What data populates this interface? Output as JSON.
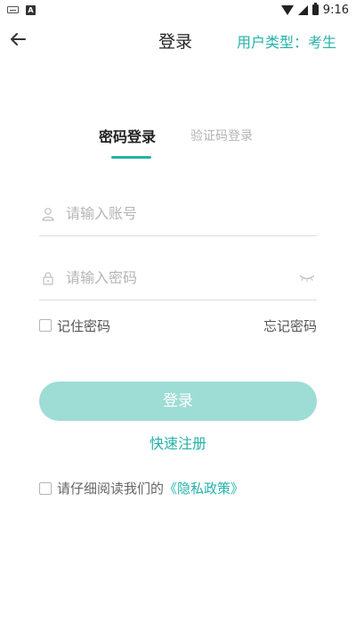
{
  "status_bar": {
    "time": "9:16"
  },
  "header": {
    "title": "登录",
    "user_type": "用户类型：考生"
  },
  "tabs": {
    "password_login": "密码登录",
    "code_login": "验证码登录"
  },
  "form": {
    "account_placeholder": "请输入账号",
    "password_placeholder": "请输入密码",
    "remember_label": "记住密码",
    "forgot_label": "忘记密码",
    "login_button": "登录",
    "register_link": "快速注册"
  },
  "privacy": {
    "prefix": "请仔细阅读我们的",
    "link": "《隐私政策》"
  },
  "colors": {
    "accent": "#25b2aa",
    "button_bg": "#9edcd6"
  }
}
